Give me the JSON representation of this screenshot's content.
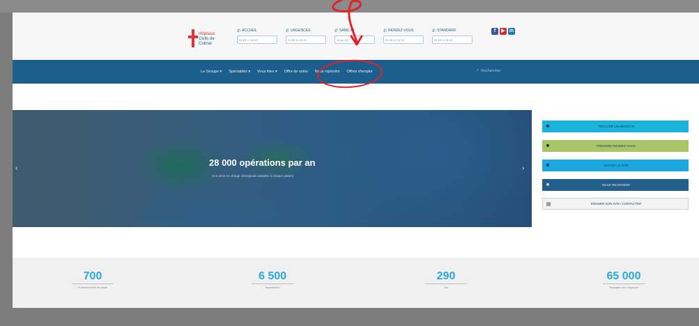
{
  "logo": {
    "line1": "Hôpitaux",
    "line2": "Civils de Colmar"
  },
  "contacts": [
    {
      "icon": "phone-icon",
      "title": "ACCUEIL",
      "value": "03 89 12 40 00"
    },
    {
      "icon": "phone-icon",
      "title": "URGENCES",
      "value": "03 89 12 40 00"
    },
    {
      "icon": "phone-icon",
      "title": "SAMU 68",
      "value": "15 ou 112"
    },
    {
      "icon": "phone-icon",
      "title": "RENDEZ-VOUS",
      "value": "03 89 12 40 00"
    },
    {
      "icon": "phone-icon",
      "title": "STANDARD",
      "value": "03 89 12 40 00"
    }
  ],
  "socials": [
    {
      "name": "facebook-icon",
      "glyph": "f",
      "color": "#3b5998"
    },
    {
      "name": "youtube-icon",
      "glyph": "▶",
      "color": "#d3282f"
    },
    {
      "name": "linkedin-icon",
      "glyph": "in",
      "color": "#1b77b5"
    }
  ],
  "nav": {
    "items": [
      "Le Groupe ▾",
      "Spécialités ▾",
      "Vous êtes ▾",
      "Offre de soins",
      "Nous rejoindre",
      "Offres d'emploi"
    ],
    "search": "Rechercher"
  },
  "slider": {
    "title": "28 000 opérations par an",
    "subtitle": "Une prise en charge chirurgicale adaptée à chaque patient",
    "prev": "‹",
    "next": "›"
  },
  "quick_links": [
    {
      "icon": "doctor-icon",
      "label": "TROUVER UN MÉDECIN"
    },
    {
      "icon": "calendar-icon",
      "label": "PRENDRE RENDEZ-VOUS"
    },
    {
      "icon": "hospital-icon",
      "label": "VISITER LE SITE"
    },
    {
      "icon": "users-icon",
      "label": "NOUS REJOINDRE"
    },
    {
      "icon": "document-icon",
      "label": "DONNER SON AVIS / CONTACTER"
    }
  ],
  "stats": [
    {
      "num": "700",
      "label": "Professionnels de santé"
    },
    {
      "num": "6 500",
      "label": "Naissances"
    },
    {
      "num": "290",
      "label": "Lits"
    },
    {
      "num": "65 000",
      "label": "Passages aux urgences"
    }
  ],
  "colors": {
    "primary": "#1d5f8c",
    "accent": "#28a8dd",
    "annotation": "#e0222a"
  }
}
